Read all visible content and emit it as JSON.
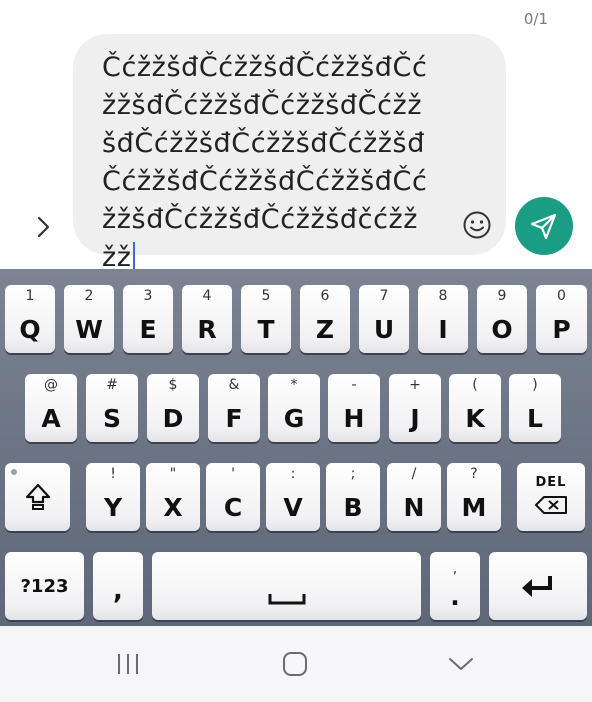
{
  "compose": {
    "counter": "0/1",
    "message_text": "ČćžžšđČćžžšđČćžžšđČćžžšđČćžžšđČćžžšđČćžžšđČćžžšđČćžžšđČćžžšđČćžžšđČćžžšđČćžžšđČćžžšđČćžžšđČćžžšđčćžžžž",
    "colors": {
      "send_button": "#1a9d84",
      "caret": "#2f6fe0"
    },
    "icons": {
      "expand": "chevron-right-icon",
      "emoji": "smiley-icon",
      "send": "send-icon"
    }
  },
  "keyboard": {
    "row1": [
      {
        "hint": "1",
        "label": "Q"
      },
      {
        "hint": "2",
        "label": "W"
      },
      {
        "hint": "3",
        "label": "E"
      },
      {
        "hint": "4",
        "label": "R"
      },
      {
        "hint": "5",
        "label": "T"
      },
      {
        "hint": "6",
        "label": "Z"
      },
      {
        "hint": "7",
        "label": "U"
      },
      {
        "hint": "8",
        "label": "I"
      },
      {
        "hint": "9",
        "label": "O"
      },
      {
        "hint": "0",
        "label": "P"
      }
    ],
    "row2": [
      {
        "hint": "@",
        "label": "A"
      },
      {
        "hint": "#",
        "label": "S"
      },
      {
        "hint": "$",
        "label": "D"
      },
      {
        "hint": "&",
        "label": "F"
      },
      {
        "hint": "*",
        "label": "G"
      },
      {
        "hint": "-",
        "label": "H"
      },
      {
        "hint": "+",
        "label": "J"
      },
      {
        "hint": "(",
        "label": "K"
      },
      {
        "hint": ")",
        "label": "L"
      }
    ],
    "row3": [
      {
        "hint": "!",
        "label": "Y"
      },
      {
        "hint": "\"",
        "label": "X"
      },
      {
        "hint": "'",
        "label": "C"
      },
      {
        "hint": ":",
        "label": "V"
      },
      {
        "hint": ";",
        "label": "B"
      },
      {
        "hint": "/",
        "label": "N"
      },
      {
        "hint": "?",
        "label": "M"
      }
    ],
    "shift_icon": "shift-icon",
    "del_label": "DEL",
    "symbols_label": "?123",
    "comma_label": ",",
    "period_hint": ",",
    "period_label": ".",
    "space_icon": "space-icon",
    "enter_icon": "enter-icon"
  },
  "navbar": {
    "recent_icon": "recent-apps-icon",
    "home_icon": "home-icon",
    "back_icon": "back-chevron-icon"
  }
}
